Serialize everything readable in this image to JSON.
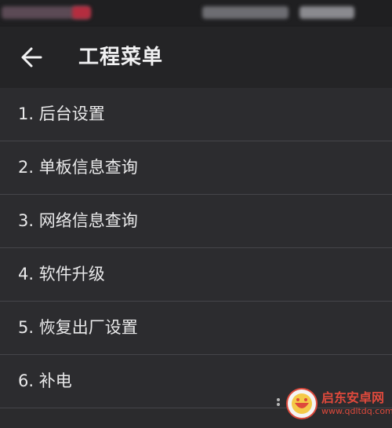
{
  "header": {
    "title": "工程菜单",
    "back_icon": "arrow-left-icon"
  },
  "menu": {
    "items": [
      {
        "label": "1. 后台设置"
      },
      {
        "label": "2. 单板信息查询"
      },
      {
        "label": "3. 网络信息查询"
      },
      {
        "label": "4. 软件升级"
      },
      {
        "label": "5. 恢复出厂设置"
      },
      {
        "label": "6. 补电"
      }
    ]
  },
  "watermark": {
    "title": "启东安卓网",
    "url": "www.qdltdq.com",
    "color": "#e84b3d"
  },
  "colors": {
    "background": "#2b2b2d",
    "app_bar": "#242426",
    "divider": "#45454a",
    "text": "#e9e9ea"
  }
}
